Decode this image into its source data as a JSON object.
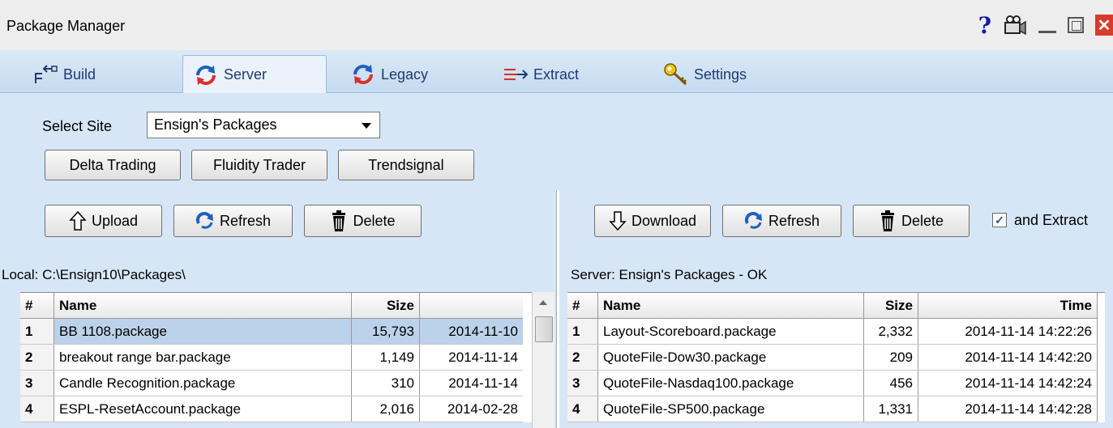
{
  "window": {
    "title": "Package Manager",
    "help_glyph": "?",
    "close_glyph": "✕"
  },
  "tabs": [
    {
      "label": "Build"
    },
    {
      "label": "Server",
      "active": true
    },
    {
      "label": "Legacy"
    },
    {
      "label": "Extract"
    },
    {
      "label": "Settings"
    }
  ],
  "site": {
    "label": "Select Site",
    "selected": "Ensign's Packages",
    "quick_buttons": [
      "Delta Trading",
      "Fluidity Trader",
      "Trendsignal"
    ]
  },
  "local": {
    "buttons": {
      "upload": "Upload",
      "refresh": "Refresh",
      "delete": "Delete"
    },
    "path_label": "Local:  C:\\Ensign10\\Packages\\",
    "columns": {
      "num": "#",
      "name": "Name",
      "size": "Size",
      "time": ""
    },
    "rows": [
      {
        "num": "1",
        "name": "BB 1108.package",
        "size": "15,793",
        "time": "2014-11-10"
      },
      {
        "num": "2",
        "name": "breakout range bar.package",
        "size": "1,149",
        "time": "2014-11-14"
      },
      {
        "num": "3",
        "name": "Candle Recognition.package",
        "size": "310",
        "time": "2014-11-14"
      },
      {
        "num": "4",
        "name": "ESPL-ResetAccount.package",
        "size": "2,016",
        "time": "2014-02-28"
      }
    ]
  },
  "server": {
    "buttons": {
      "download": "Download",
      "refresh": "Refresh",
      "delete": "Delete"
    },
    "extract_label": "and Extract",
    "extract_checked": true,
    "path_label": "Server:  Ensign's Packages  -  OK",
    "columns": {
      "num": "#",
      "name": "Name",
      "size": "Size",
      "time": "Time"
    },
    "rows": [
      {
        "num": "1",
        "name": "Layout-Scoreboard.package",
        "size": "2,332",
        "time": "2014-11-14 14:22:26"
      },
      {
        "num": "2",
        "name": "QuoteFile-Dow30.package",
        "size": "209",
        "time": "2014-11-14 14:42:20"
      },
      {
        "num": "3",
        "name": "QuoteFile-Nasdaq100.package",
        "size": "456",
        "time": "2014-11-14 14:42:24"
      },
      {
        "num": "4",
        "name": "QuoteFile-SP500.package",
        "size": "1,331",
        "time": "2014-11-14 14:42:28"
      }
    ]
  },
  "colors": {
    "panel": "#d6e6f6",
    "tabbar": "#c5dbf1",
    "selection": "#bcd2ea",
    "refresh_icon": "#1f5fbf",
    "close": "#d93a2b"
  },
  "icons": [
    "build-icon",
    "server-refresh-icon",
    "legacy-refresh-icon",
    "extract-icon",
    "key-icon",
    "help-icon",
    "camera-icon",
    "minimize-icon",
    "maximize-icon",
    "close-icon",
    "upload-arrow-icon",
    "refresh-icon",
    "trash-icon",
    "download-arrow-icon"
  ]
}
